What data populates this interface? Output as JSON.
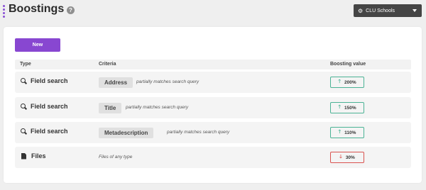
{
  "header": {
    "title": "Boostings",
    "help_icon": "?",
    "school_select": {
      "value": "CLU Schools",
      "icon": "cog-icon"
    }
  },
  "toolbar": {
    "new_label": "New"
  },
  "table": {
    "columns": [
      "Type",
      "Criteria",
      "Boosting value"
    ],
    "rows": [
      {
        "type": "Field search",
        "type_icon": "search-icon",
        "field": "Address",
        "criteria": "partially matches search query",
        "boost": "200%",
        "direction": "up"
      },
      {
        "type": "Field search",
        "type_icon": "search-icon",
        "field": "Title",
        "criteria": "partially matches search query",
        "boost": "150%",
        "direction": "up"
      },
      {
        "type": "Field search",
        "type_icon": "search-icon",
        "field": "Metadescription",
        "criteria": "partially matches search query",
        "boost": "110%",
        "direction": "up"
      },
      {
        "type": "Files",
        "type_icon": "file-icon",
        "field": "",
        "criteria": "Files of any type",
        "boost": "30%",
        "direction": "down"
      }
    ]
  },
  "colors": {
    "accent": "#8847d1",
    "up": "#4bb395",
    "down": "#d9534f"
  }
}
